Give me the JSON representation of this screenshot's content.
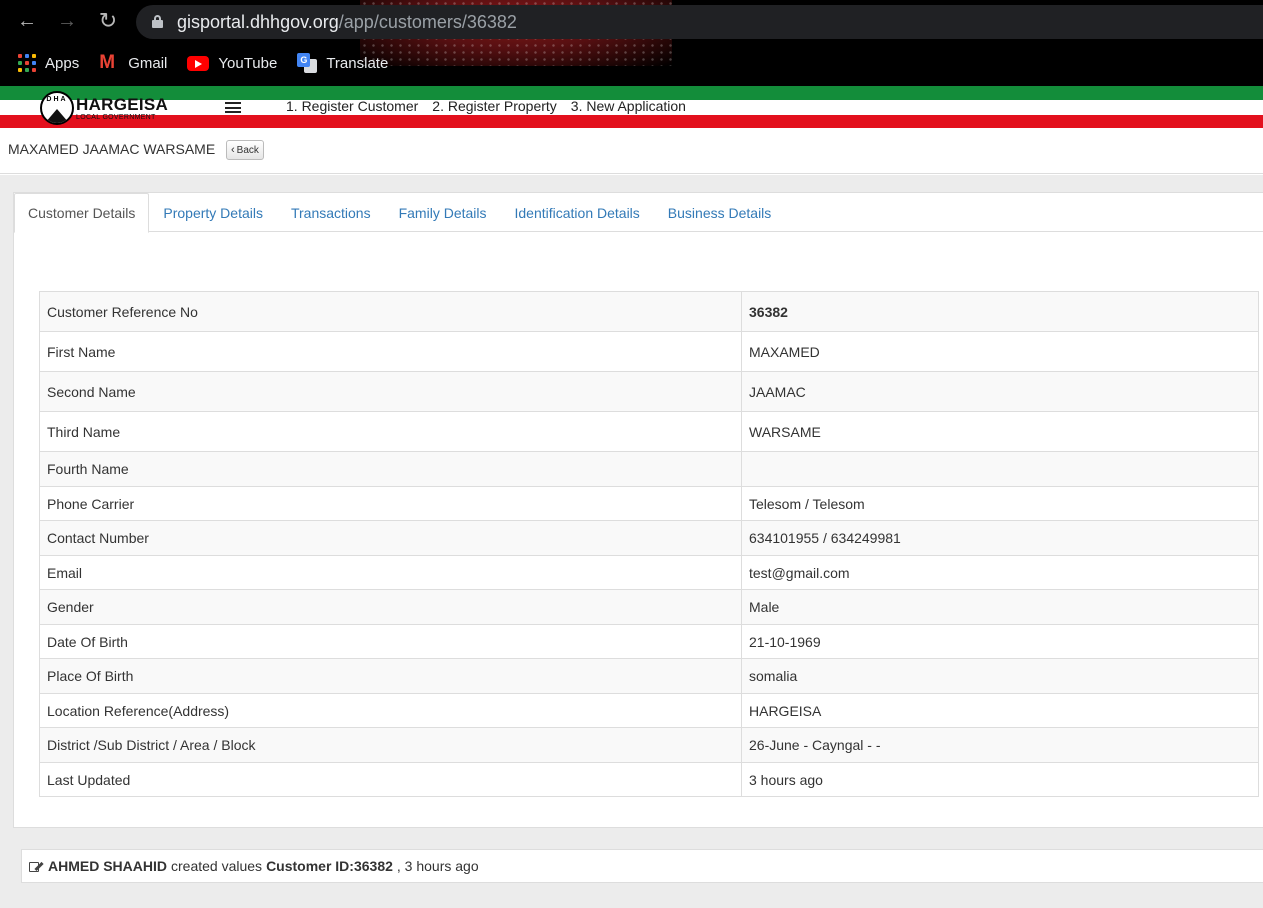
{
  "browser": {
    "url_host": "gisportal.dhhgov.org",
    "url_path": "/app/customers/36382",
    "bookmarks": [
      {
        "label": "Apps",
        "icon": "apps-grid-icon"
      },
      {
        "label": "Gmail",
        "icon": "gmail-icon"
      },
      {
        "label": "YouTube",
        "icon": "youtube-icon"
      },
      {
        "label": "Translate",
        "icon": "translate-icon"
      }
    ]
  },
  "header": {
    "logo_title": "HARGEISA",
    "logo_subtitle": "LOCAL GOVERNMENT",
    "logo_emblem_text": "DHA",
    "nav": [
      "1. Register Customer",
      "2. Register Property",
      "3. New Application"
    ],
    "colors": {
      "green": "#138d3a",
      "red": "#e3101d"
    }
  },
  "page": {
    "title": "MAXAMED JAAMAC WARSAME",
    "back_label": "Back"
  },
  "tabs": [
    {
      "label": "Customer Details",
      "active": true
    },
    {
      "label": "Property Details",
      "active": false
    },
    {
      "label": "Transactions",
      "active": false
    },
    {
      "label": "Family Details",
      "active": false
    },
    {
      "label": "Identification Details",
      "active": false
    },
    {
      "label": "Business Details",
      "active": false
    }
  ],
  "details": [
    {
      "label": "Customer Reference No",
      "value": "36382"
    },
    {
      "label": "First Name",
      "value": "MAXAMED"
    },
    {
      "label": "Second Name",
      "value": "JAAMAC"
    },
    {
      "label": "Third Name",
      "value": "WARSAME"
    },
    {
      "label": "Fourth Name",
      "value": ""
    },
    {
      "label": "Phone Carrier",
      "value": "Telesom / Telesom"
    },
    {
      "label": "Contact Number",
      "value": "634101955 / 634249981"
    },
    {
      "label": "Email",
      "value": "test@gmail.com"
    },
    {
      "label": "Gender",
      "value": "Male"
    },
    {
      "label": "Date Of Birth",
      "value": "21-10-1969"
    },
    {
      "label": "Place Of Birth",
      "value": "somalia"
    },
    {
      "label": "Location Reference(Address)",
      "value": "HARGEISA"
    },
    {
      "label": "District /Sub District / Area / Block",
      "value": "26-June - Cayngal - -"
    },
    {
      "label": "Last Updated",
      "value": "3 hours ago"
    }
  ],
  "activity": {
    "user": "AHMED SHAAHID",
    "action": "created values",
    "target": "Customer ID:36382",
    "time": ", 3 hours ago"
  }
}
